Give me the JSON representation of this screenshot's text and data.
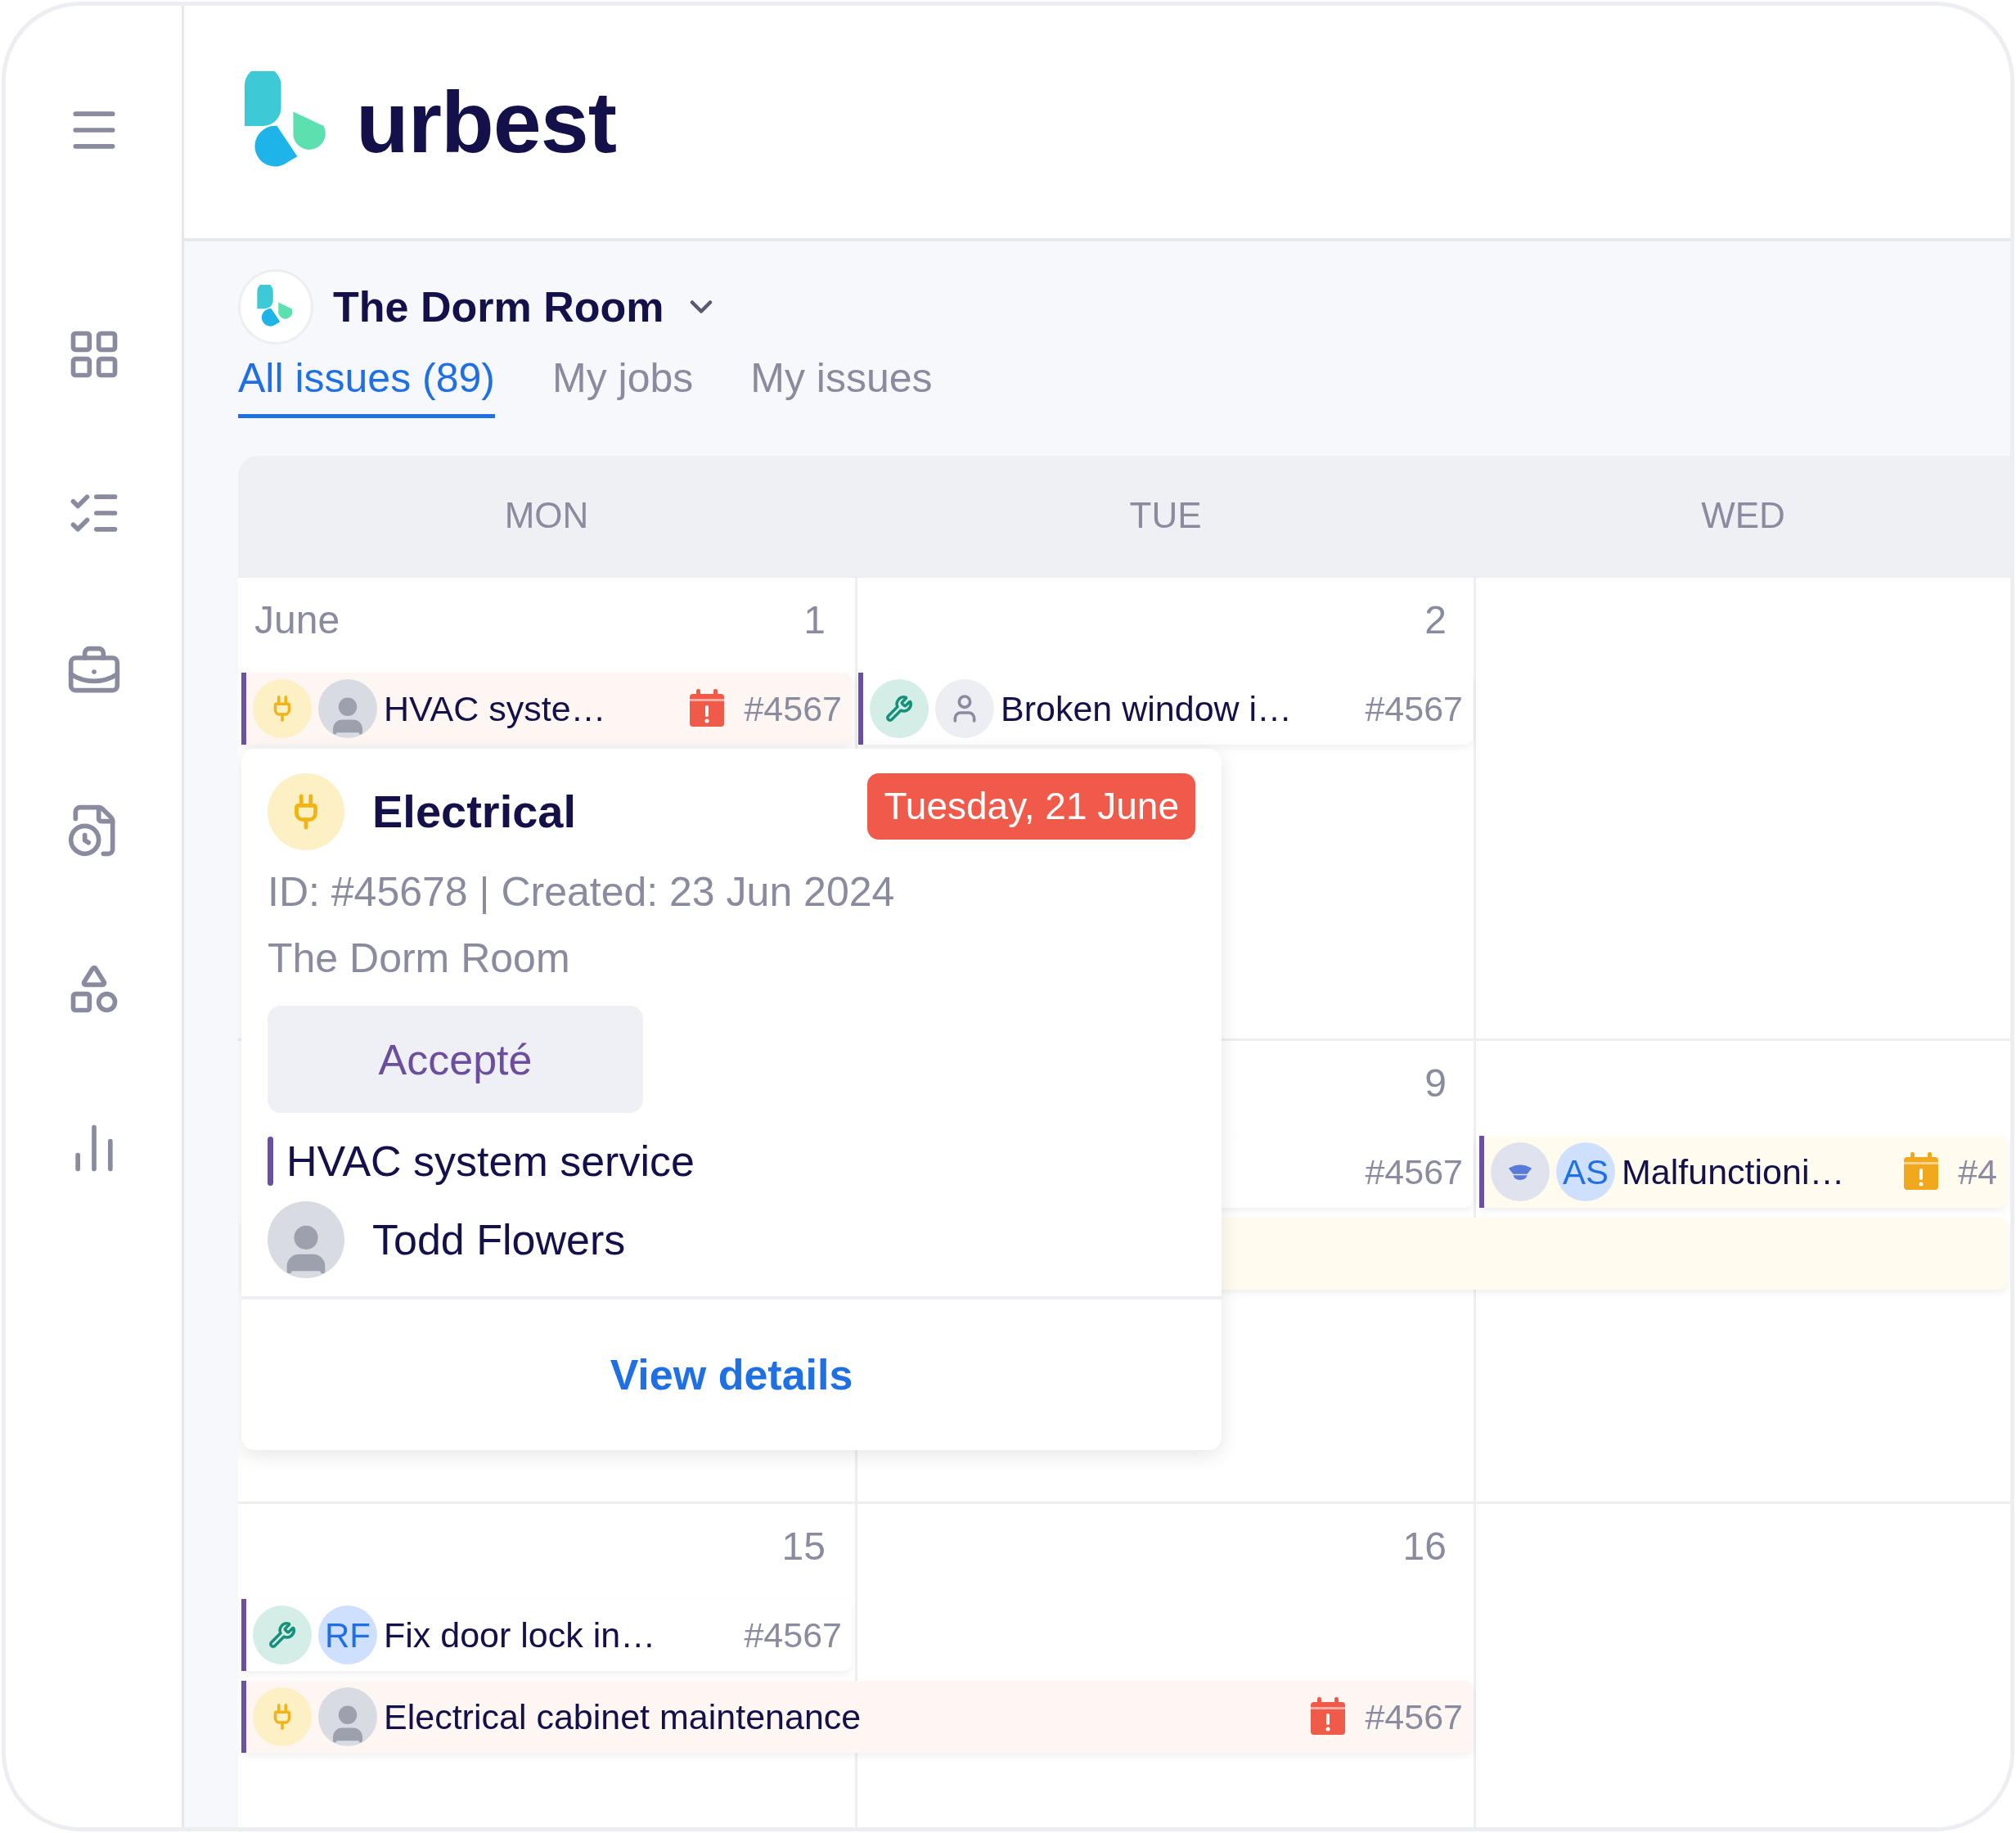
{
  "logo": {
    "wordmark": "urbest"
  },
  "workspace": {
    "name": "The Dorm Room"
  },
  "tabs": [
    {
      "label": "All issues (89)",
      "selected": true
    },
    {
      "label": "My jobs",
      "selected": false
    },
    {
      "label": "My issues",
      "selected": false
    }
  ],
  "calendar": {
    "days": [
      "MON",
      "TUE",
      "WED"
    ],
    "weeks": [
      {
        "dates": [
          {
            "kind": "day",
            "month": "June",
            "date": "1"
          },
          {
            "kind": "day",
            "date": "2"
          },
          {
            "kind": "blank"
          }
        ],
        "lanes": [
          [
            {
              "kind": "overdue",
              "badge": {
                "kind": "electrical"
              },
              "assignee": {
                "kind": "photo"
              },
              "title": "HVAC syste…",
              "ref": "#4567"
            },
            {
              "kind": "plain",
              "badge": {
                "kind": "tools"
              },
              "assignee": {
                "kind": "none"
              },
              "title": "Broken window i…",
              "ref": "#4567"
            },
            {
              "kind": "empty"
            }
          ]
        ]
      },
      {
        "dates": [
          {
            "kind": "blank"
          },
          {
            "kind": "day",
            "date": "9"
          },
          {
            "kind": "blank"
          }
        ],
        "lanes": [
          [
            {
              "kind": "empty"
            },
            {
              "kind": "plain",
              "ref": "#4567"
            },
            {
              "kind": "warning",
              "badge": {
                "kind": "security"
              },
              "assignee": {
                "kind": "initials",
                "initials": "AS"
              },
              "title": "Malfunctioni…",
              "ref": "#4"
            }
          ],
          [
            {
              "kind": "band"
            },
            {
              "kind": "continued"
            },
            {
              "kind": "continued"
            }
          ]
        ]
      },
      {
        "dates": [
          {
            "kind": "day",
            "date": "15"
          },
          {
            "kind": "day",
            "date": "16"
          },
          {
            "kind": "blank"
          }
        ],
        "lanes": [
          [
            {
              "kind": "plain",
              "badge": {
                "kind": "tools"
              },
              "assignee": {
                "kind": "initials",
                "initials": "RF"
              },
              "title": "Fix door lock in…",
              "ref": "#4567"
            },
            {
              "kind": "empty"
            },
            {
              "kind": "empty"
            }
          ],
          [
            {
              "kind": "overdue",
              "badge": {
                "kind": "electrical"
              },
              "assignee": {
                "kind": "photo"
              },
              "title": "Electrical cabinet maintenance",
              "ref": "#4567"
            },
            {
              "kind": "continued"
            },
            {
              "kind": "empty"
            }
          ]
        ]
      }
    ]
  },
  "popup": {
    "badge": {
      "kind": "electrical"
    },
    "title": "Electrical",
    "due": "Tuesday, 21 June",
    "meta": "ID: #45678 | Created: 23 Jun 2024",
    "location": "The Dorm Room",
    "status": "Accepté",
    "issue": "HVAC system service",
    "assignee": {
      "kind": "photo",
      "name": "Todd Flowers"
    },
    "action": "View details"
  }
}
